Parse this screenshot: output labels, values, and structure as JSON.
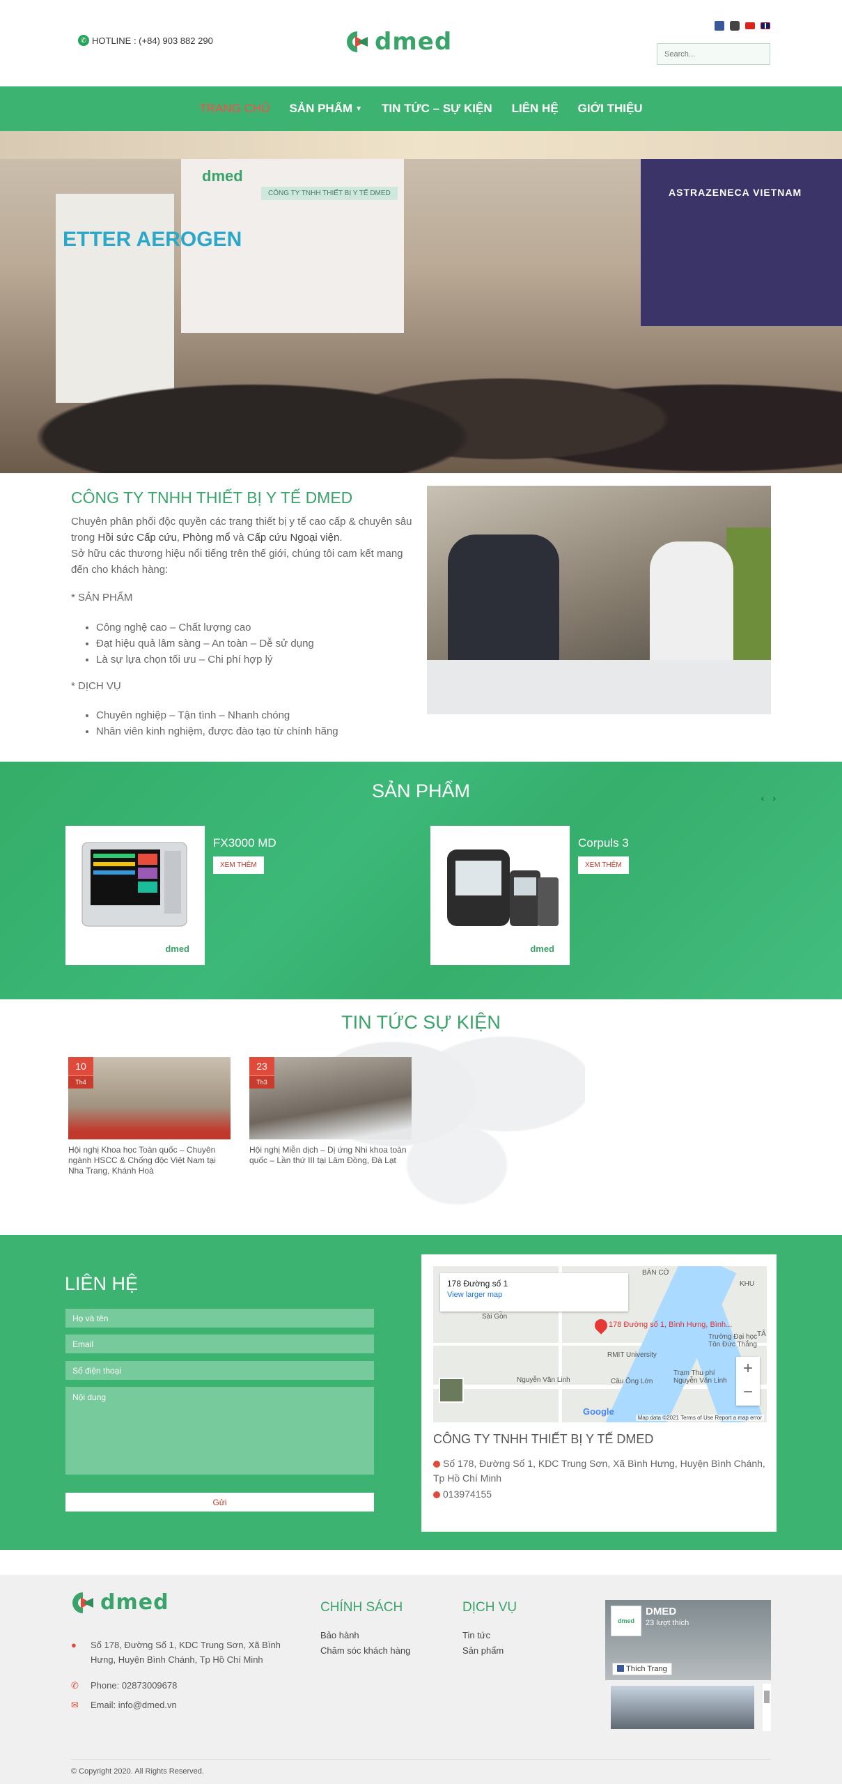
{
  "header": {
    "hotline": "HOTLINE : (+84) 903 882 290",
    "logo_text": "dmed",
    "search_placeholder": "Search..."
  },
  "nav": {
    "items": [
      {
        "label": "TRANG CHỦ",
        "active": true
      },
      {
        "label": "SẢN PHẨM",
        "active": false,
        "caret": true
      },
      {
        "label": "TIN TỨC – SỰ KIỆN",
        "active": false
      },
      {
        "label": "LIÊN HỆ",
        "active": false
      },
      {
        "label": "GIỚI THIỆU",
        "active": false
      }
    ]
  },
  "hero": {
    "brand": "dmed",
    "booth_label": "CÔNG TY TNHH THIẾT BỊ Y TẾ DMED",
    "booth_right": "ASTRAZENECA VIETNAM",
    "banner_left": "ETTER AEROGEN"
  },
  "intro": {
    "title": "CÔNG TY TNHH THIẾT BỊ Y TẾ DMED",
    "desc_1": "Chuyên phân phối độc quyền các trang thiết bị y tế cao cấp & chuyên sâu trong ",
    "desc_bold_1": "Hồi sức Cấp cứu",
    "desc_2": ", ",
    "desc_bold_2": "Phòng mổ",
    "desc_3": " và ",
    "desc_bold_3": "Cấp cứu Ngoại viện",
    "desc_4": ".",
    "desc_5": "Sở hữu các thương hiệu nổi tiếng trên thế giới, chúng tôi cam kết mang đến cho khách hàng:",
    "products_heading": "* SẢN PHẨM",
    "products_list": [
      "Công nghệ cao – Chất lượng cao",
      "Đạt hiệu quả lâm sàng – An toàn – Dễ sử dụng",
      "Là sự lựa chọn tối ưu – Chi phí hợp lý"
    ],
    "services_heading": "* DỊCH VỤ",
    "services_list": [
      "Chuyên nghiệp – Tận tình – Nhanh chóng",
      "Nhân viên kinh nghiệm, được đào tạo từ chính hãng"
    ]
  },
  "products": {
    "title": "SẢN PHẨM",
    "prev": "‹",
    "next": "›",
    "items": [
      {
        "name": "FX3000 MD",
        "button": "XEM THÊM",
        "logo": "dmed"
      },
      {
        "name": "Corpuls 3",
        "button": "XEM THÊM",
        "logo": "dmed"
      }
    ]
  },
  "news": {
    "title": "TIN TỨC SỰ KIỆN",
    "items": [
      {
        "day": "10",
        "month": "Th4",
        "title": "Hội nghị Khoa học Toàn quốc – Chuyên ngành HSCC & Chống độc Việt Nam tại Nha Trang, Khánh Hoà"
      },
      {
        "day": "23",
        "month": "Th3",
        "title": "Hội nghị Miễn dịch – Dị ứng Nhi khoa toàn quốc – Lần thứ III tại Lâm Đồng, Đà Lạt"
      }
    ]
  },
  "contact": {
    "title": "LIÊN HỆ",
    "name_placeholder": "Họ và tên",
    "email_placeholder": "Email",
    "phone_placeholder": "Số điện thoại",
    "message_placeholder": "Nội dung",
    "send_label": "Gửi",
    "map": {
      "popup_title": "178 Đường số 1",
      "popup_link": "View larger map",
      "pin_label": "178 Đường số 1, Bình Hưng, Bình...",
      "footer": "Map data ©2021   Terms of Use   Report a map error",
      "google": "Google",
      "labels": [
        "BÀN CỜ",
        "Chung cư Him Lam Nam Sài Gòn",
        "RMIT University",
        "Nguyễn Văn Linh",
        "Trường Đại học Tôn Đức Thắng",
        "Trạm Thu phí Nguyễn Văn Linh",
        "Cầu Ông Lớn",
        "KHU",
        "TÂ"
      ]
    },
    "company": "CÔNG TY TNHH THIẾT BỊ Y TẾ DMED",
    "address": "Số 178, Đường Số 1, KDC Trung Sơn, Xã Bình Hưng, Huyện Bình Chánh, Tp Hồ Chí Minh",
    "phone": "013974155"
  },
  "footer": {
    "logo_text": "dmed",
    "address": "Số 178, Đường Số 1, KDC Trung Sơn, Xã Bình Hưng, Huyện Bình Chánh, Tp Hồ Chí Minh",
    "phone": "Phone: 02873009678",
    "email": "Email: info@dmed.vn",
    "policy_title": "CHÍNH SÁCH",
    "policy_links": [
      "Bảo hành",
      "Chăm sóc khách hàng"
    ],
    "service_title": "DỊCH VỤ",
    "service_links": [
      "Tin tức",
      "Sản phẩm"
    ],
    "fb_name": "DMED",
    "fb_likes": "23 lượt thích",
    "fb_like_button": "Thích Trang",
    "fb_avatar": "dmed",
    "copyright": "© Copyright 2020. All Rights Reserved."
  },
  "colors": {
    "brand_green": "#3cb371",
    "accent_red": "#e04a3a"
  }
}
